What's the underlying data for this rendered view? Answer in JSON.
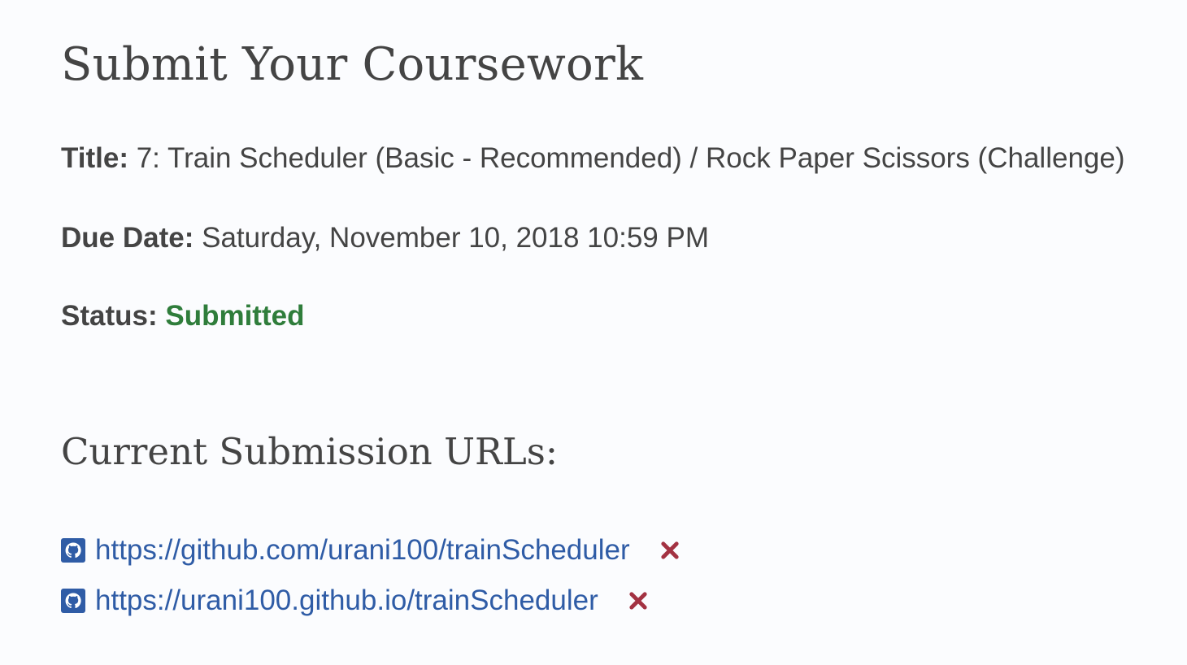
{
  "page": {
    "title": "Submit Your Coursework"
  },
  "assignment": {
    "title_label": "Title:",
    "title_value": "7: Train Scheduler (Basic - Recommended) / Rock Paper Scissors (Challenge)",
    "due_label": "Due Date:",
    "due_value": "Saturday, November 10, 2018 10:59 PM",
    "status_label": "Status:",
    "status_value": "Submitted",
    "status_color": "#2f7d3b"
  },
  "submissions": {
    "heading": "Current Submission URLs:",
    "items": [
      {
        "url": "https://github.com/urani100/trainScheduler",
        "icon": "github-icon",
        "remove_icon": "close-icon"
      },
      {
        "url": "https://urani100.github.io/trainScheduler",
        "icon": "github-icon",
        "remove_icon": "close-icon"
      }
    ]
  },
  "colors": {
    "background": "#fbfcfe",
    "text": "#444444",
    "link": "#2f5ca6",
    "remove": "#a33242"
  }
}
